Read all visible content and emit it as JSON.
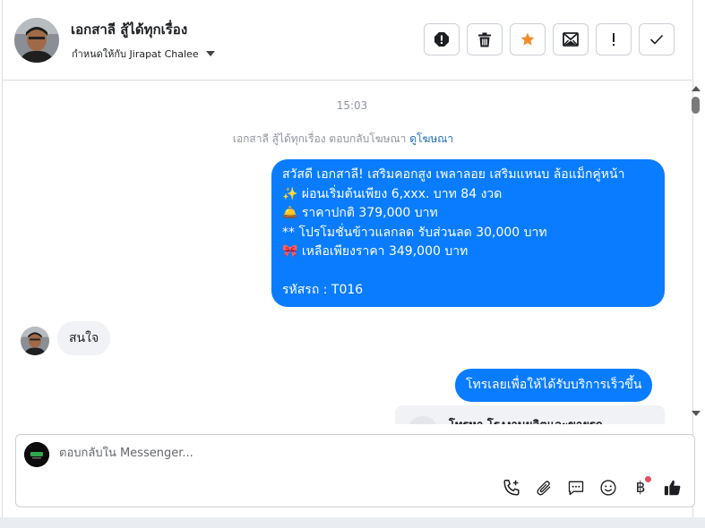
{
  "header": {
    "contact_name": "เอกสาลี สู้ได้ทุกเรื่อง",
    "assigned_label": "กำหนดให้กับ Jirapat Chalee",
    "tools": [
      {
        "icon": "alert-icon",
        "label": "Spam"
      },
      {
        "icon": "trash-icon",
        "label": "Delete"
      },
      {
        "icon": "star-icon",
        "label": "Star"
      },
      {
        "icon": "mark-unread-icon",
        "label": "Mark unread"
      },
      {
        "icon": "exclamation-icon",
        "label": "Follow up"
      },
      {
        "icon": "check-icon",
        "label": "Done"
      }
    ],
    "star_color": "#f28b2b"
  },
  "messages": {
    "timestamp": "15:03",
    "ad_note_prefix": "เอกสาลี สู้ได้ทุกเรื่อง ตอบกลับโฆษณา",
    "ad_note_link": "ดูโฆษณา",
    "outgoing_1": {
      "lines": [
        "สวัสดี เอกสาลี! เสริมคอกสูง เพลาลอย เสริมแหนบ ล้อแม็กคู่หน้า",
        "✨  ผ่อนเริ่มต้นเพียง 6,xxx. บาท 84 งวด",
        "🛎️ ราคาปกติ 379,000 บาท",
        "** โปรโมชั่นข้าวแลกลด รับส่วนลด 30,000 บาท",
        "🎀  เหลือเพียงราคา 349,000 บาท",
        "",
        " รหัสรถ : T016"
      ]
    },
    "incoming_1": "สนใจ",
    "outgoing_2": "โทรเลยเพื่อให้ได้รับบริการเร็วขึ้น",
    "card_preview_title": "โทรหา โรงงานผลิตและขายรถ"
  },
  "composer": {
    "placeholder": "ตอบกลับใน Messenger...",
    "tools": [
      "call-add-icon",
      "attachment-icon",
      "saved-reply-icon",
      "emoji-icon",
      "baht-payment-icon",
      "like-icon"
    ]
  },
  "colors": {
    "outgoing_bubble": "#0a7cff",
    "incoming_bubble": "#f0f2f5",
    "link": "#1d6fb8"
  }
}
